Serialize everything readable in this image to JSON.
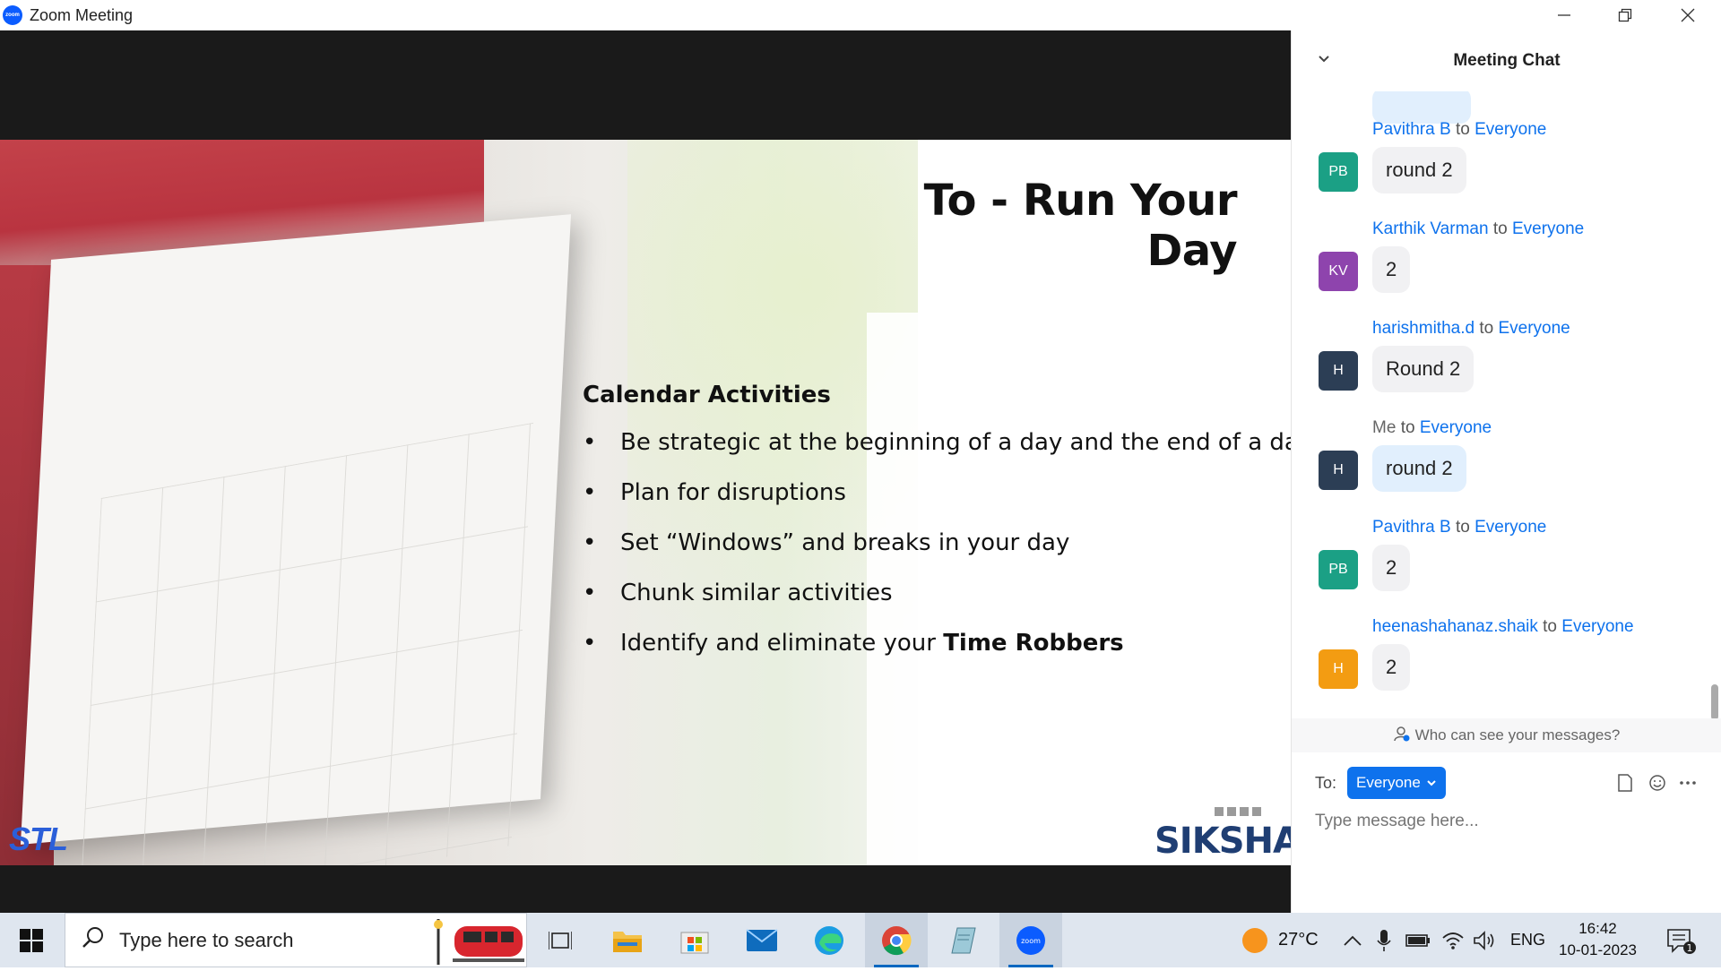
{
  "window": {
    "title": "Zoom Meeting",
    "app_icon_text": "zoom"
  },
  "slide": {
    "title": "To - Run Your Day",
    "section_title": "Calendar Activities",
    "bullets": [
      "Be strategic at the beginning of a day and the end of a day",
      "Plan for disruptions",
      "Set “Windows” and breaks in your day",
      "Chunk similar activities"
    ],
    "last_bullet_prefix": "Identify and eliminate your ",
    "last_bullet_bold": "Time Robbers",
    "logo_left": "STL",
    "logo_right": "SIKSHA"
  },
  "chat": {
    "title": "Meeting Chat",
    "messages": [
      {
        "initials": "PB",
        "sender": "Pavithra B",
        "to_word": "to",
        "recipient": "Everyone",
        "text": "round 2",
        "avatar_color": "#1ba085",
        "mine": false
      },
      {
        "initials": "KV",
        "sender": "Karthik Varman",
        "to_word": "to",
        "recipient": "Everyone",
        "text": "2",
        "avatar_color": "#8e44ad",
        "mine": false
      },
      {
        "initials": "H",
        "sender": "harishmitha.d",
        "to_word": "to",
        "recipient": "Everyone",
        "text": "Round 2",
        "avatar_color": "#2c3e55",
        "mine": false
      },
      {
        "initials": "H",
        "sender": "Me",
        "to_word": "to",
        "recipient": "Everyone",
        "text": "round 2",
        "avatar_color": "#2c3e55",
        "mine": true
      },
      {
        "initials": "PB",
        "sender": "Pavithra B",
        "to_word": "to",
        "recipient": "Everyone",
        "text": "2",
        "avatar_color": "#1ba085",
        "mine": false
      },
      {
        "initials": "H",
        "sender": "heenashahanaz.shaik",
        "to_word": "to",
        "recipient": "Everyone",
        "text": "2",
        "avatar_color": "#f39c12",
        "mine": false
      }
    ],
    "privacy_text": "Who can see your messages?",
    "to_label": "To:",
    "to_selected": "Everyone",
    "input_placeholder": "Type message here..."
  },
  "taskbar": {
    "search_placeholder": "Type here to search",
    "weather": "27°C",
    "language": "ENG",
    "time": "16:42",
    "date": "10-01-2023",
    "notification_count": "1",
    "apps": [
      "task-view",
      "file-explorer",
      "microsoft-store",
      "mail",
      "edge",
      "chrome",
      "notepad",
      "zoom"
    ]
  },
  "colors": {
    "accent": "#0e72ed",
    "zoom_blue": "#0b5cff",
    "taskbar": "#dfe6ef"
  }
}
